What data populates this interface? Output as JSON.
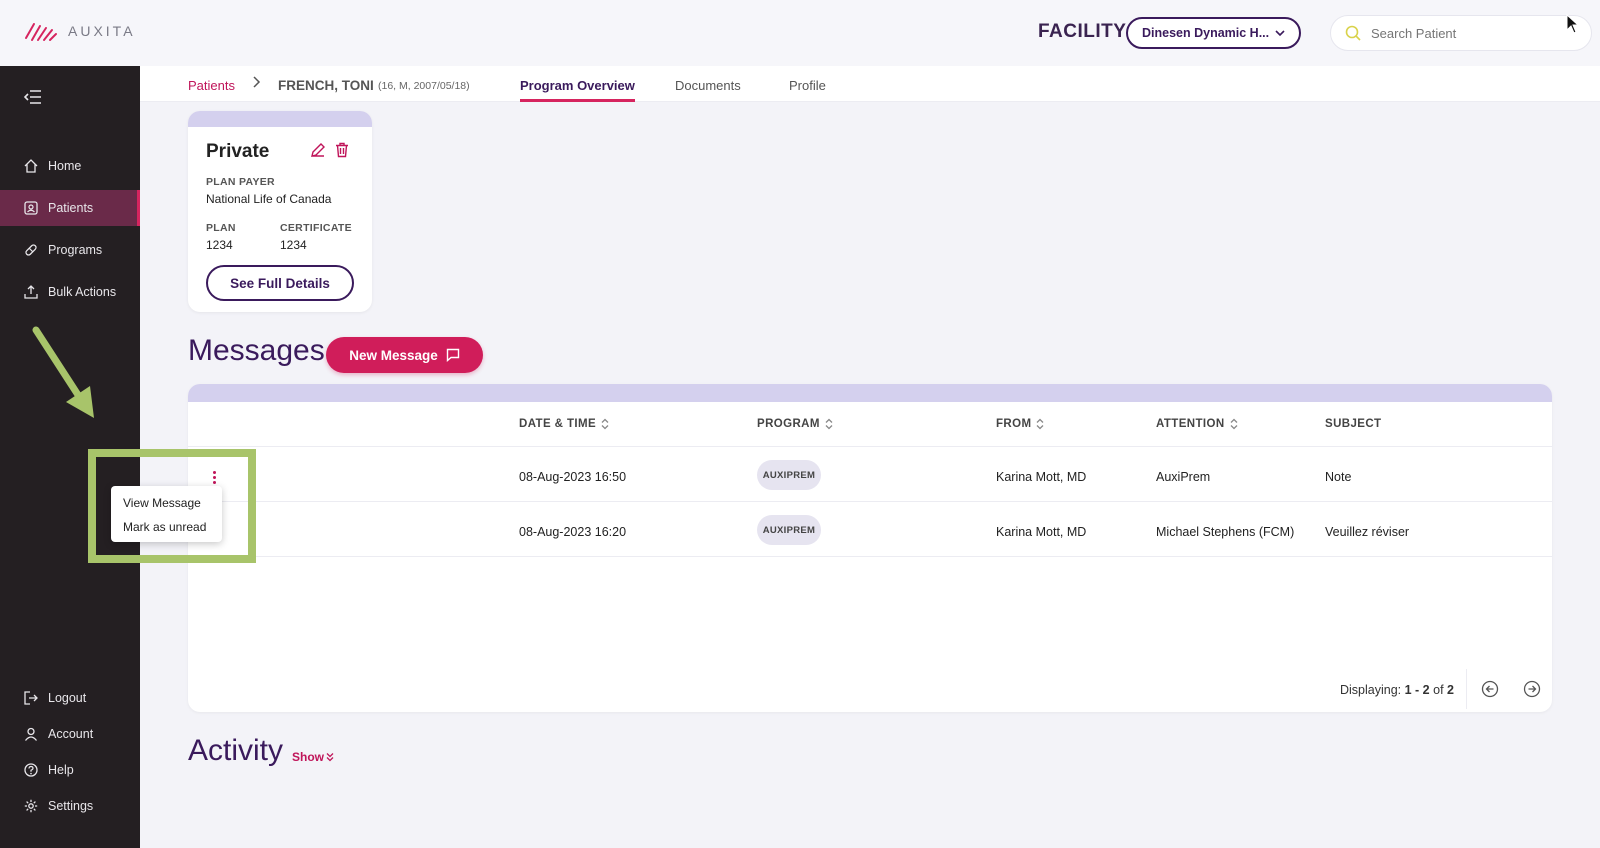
{
  "header": {
    "logo_text": "AUXITA",
    "facility_label": "FACILITY",
    "facility_value": "Dinesen Dynamic H...",
    "search_placeholder": "Search Patient"
  },
  "sidebar": {
    "items": [
      {
        "label": "Home",
        "icon": "home-icon"
      },
      {
        "label": "Patients",
        "icon": "patients-icon",
        "active": true
      },
      {
        "label": "Programs",
        "icon": "pill-icon"
      },
      {
        "label": "Bulk Actions",
        "icon": "upload-icon"
      }
    ],
    "bottom_items": [
      {
        "label": "Logout",
        "icon": "logout-icon"
      },
      {
        "label": "Account",
        "icon": "user-icon"
      },
      {
        "label": "Help",
        "icon": "help-icon"
      },
      {
        "label": "Settings",
        "icon": "gear-icon"
      }
    ]
  },
  "breadcrumb": {
    "patients": "Patients",
    "name": "FRENCH, TONI",
    "meta": "(16, M, 2007/05/18)"
  },
  "tabs": [
    {
      "label": "Program Overview",
      "active": true
    },
    {
      "label": "Documents"
    },
    {
      "label": "Profile"
    }
  ],
  "plan_card": {
    "title": "Private",
    "payer_label": "PLAN PAYER",
    "payer_value": "National Life of Canada",
    "plan_label": "PLAN",
    "plan_value": "1234",
    "certificate_label": "CERTIFICATE",
    "certificate_value": "1234",
    "details_button": "See Full Details"
  },
  "messages": {
    "title": "Messages",
    "new_button": "New Message",
    "columns": [
      "DATE & TIME",
      "PROGRAM",
      "FROM",
      "ATTENTION",
      "SUBJECT"
    ],
    "rows": [
      {
        "datetime": "08-Aug-2023 16:50",
        "program": "AUXIPREM",
        "from": "Karina Mott, MD",
        "attention": "AuxiPrem",
        "subject": "Note"
      },
      {
        "datetime": "08-Aug-2023 16:20",
        "program": "AUXIPREM",
        "from": "Karina Mott, MD",
        "attention": "Michael Stephens (FCM)",
        "subject": "Veuillez réviser"
      }
    ],
    "pager_prefix": "Displaying: ",
    "pager_range": "1 - 2",
    "pager_of": " of ",
    "pager_total": "2"
  },
  "context_menu": {
    "items": [
      "View Message",
      "Mark as unread"
    ]
  },
  "activity": {
    "title": "Activity",
    "show_label": "Show"
  },
  "colors": {
    "accent": "#d01d5a",
    "brand_purple": "#3a1a5c",
    "sidebar_bg": "#241f22",
    "band": "#d4d0ee",
    "highlight": "#a8c46a"
  }
}
